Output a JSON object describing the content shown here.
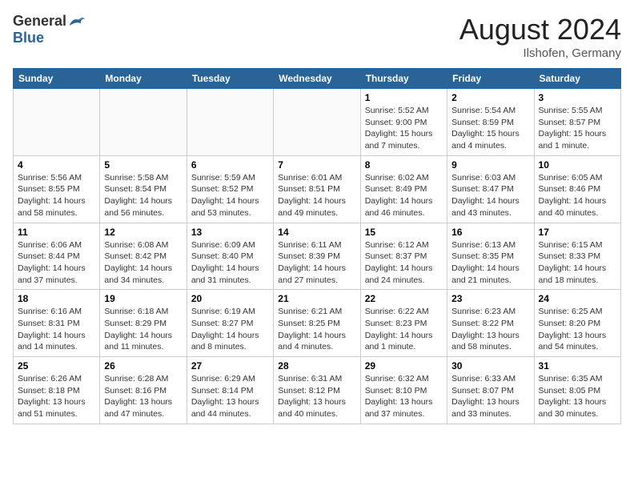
{
  "header": {
    "logo_general": "General",
    "logo_blue": "Blue",
    "month_year": "August 2024",
    "location": "Ilshofen, Germany"
  },
  "days_of_week": [
    "Sunday",
    "Monday",
    "Tuesday",
    "Wednesday",
    "Thursday",
    "Friday",
    "Saturday"
  ],
  "weeks": [
    [
      {
        "day": "",
        "empty": true
      },
      {
        "day": "",
        "empty": true
      },
      {
        "day": "",
        "empty": true
      },
      {
        "day": "",
        "empty": true
      },
      {
        "day": "1",
        "sunrise": "Sunrise: 5:52 AM",
        "sunset": "Sunset: 9:00 PM",
        "daylight": "Daylight: 15 hours and 7 minutes."
      },
      {
        "day": "2",
        "sunrise": "Sunrise: 5:54 AM",
        "sunset": "Sunset: 8:59 PM",
        "daylight": "Daylight: 15 hours and 4 minutes."
      },
      {
        "day": "3",
        "sunrise": "Sunrise: 5:55 AM",
        "sunset": "Sunset: 8:57 PM",
        "daylight": "Daylight: 15 hours and 1 minute."
      }
    ],
    [
      {
        "day": "4",
        "sunrise": "Sunrise: 5:56 AM",
        "sunset": "Sunset: 8:55 PM",
        "daylight": "Daylight: 14 hours and 58 minutes."
      },
      {
        "day": "5",
        "sunrise": "Sunrise: 5:58 AM",
        "sunset": "Sunset: 8:54 PM",
        "daylight": "Daylight: 14 hours and 56 minutes."
      },
      {
        "day": "6",
        "sunrise": "Sunrise: 5:59 AM",
        "sunset": "Sunset: 8:52 PM",
        "daylight": "Daylight: 14 hours and 53 minutes."
      },
      {
        "day": "7",
        "sunrise": "Sunrise: 6:01 AM",
        "sunset": "Sunset: 8:51 PM",
        "daylight": "Daylight: 14 hours and 49 minutes."
      },
      {
        "day": "8",
        "sunrise": "Sunrise: 6:02 AM",
        "sunset": "Sunset: 8:49 PM",
        "daylight": "Daylight: 14 hours and 46 minutes."
      },
      {
        "day": "9",
        "sunrise": "Sunrise: 6:03 AM",
        "sunset": "Sunset: 8:47 PM",
        "daylight": "Daylight: 14 hours and 43 minutes."
      },
      {
        "day": "10",
        "sunrise": "Sunrise: 6:05 AM",
        "sunset": "Sunset: 8:46 PM",
        "daylight": "Daylight: 14 hours and 40 minutes."
      }
    ],
    [
      {
        "day": "11",
        "sunrise": "Sunrise: 6:06 AM",
        "sunset": "Sunset: 8:44 PM",
        "daylight": "Daylight: 14 hours and 37 minutes."
      },
      {
        "day": "12",
        "sunrise": "Sunrise: 6:08 AM",
        "sunset": "Sunset: 8:42 PM",
        "daylight": "Daylight: 14 hours and 34 minutes."
      },
      {
        "day": "13",
        "sunrise": "Sunrise: 6:09 AM",
        "sunset": "Sunset: 8:40 PM",
        "daylight": "Daylight: 14 hours and 31 minutes."
      },
      {
        "day": "14",
        "sunrise": "Sunrise: 6:11 AM",
        "sunset": "Sunset: 8:39 PM",
        "daylight": "Daylight: 14 hours and 27 minutes."
      },
      {
        "day": "15",
        "sunrise": "Sunrise: 6:12 AM",
        "sunset": "Sunset: 8:37 PM",
        "daylight": "Daylight: 14 hours and 24 minutes."
      },
      {
        "day": "16",
        "sunrise": "Sunrise: 6:13 AM",
        "sunset": "Sunset: 8:35 PM",
        "daylight": "Daylight: 14 hours and 21 minutes."
      },
      {
        "day": "17",
        "sunrise": "Sunrise: 6:15 AM",
        "sunset": "Sunset: 8:33 PM",
        "daylight": "Daylight: 14 hours and 18 minutes."
      }
    ],
    [
      {
        "day": "18",
        "sunrise": "Sunrise: 6:16 AM",
        "sunset": "Sunset: 8:31 PM",
        "daylight": "Daylight: 14 hours and 14 minutes."
      },
      {
        "day": "19",
        "sunrise": "Sunrise: 6:18 AM",
        "sunset": "Sunset: 8:29 PM",
        "daylight": "Daylight: 14 hours and 11 minutes."
      },
      {
        "day": "20",
        "sunrise": "Sunrise: 6:19 AM",
        "sunset": "Sunset: 8:27 PM",
        "daylight": "Daylight: 14 hours and 8 minutes."
      },
      {
        "day": "21",
        "sunrise": "Sunrise: 6:21 AM",
        "sunset": "Sunset: 8:25 PM",
        "daylight": "Daylight: 14 hours and 4 minutes."
      },
      {
        "day": "22",
        "sunrise": "Sunrise: 6:22 AM",
        "sunset": "Sunset: 8:23 PM",
        "daylight": "Daylight: 14 hours and 1 minute."
      },
      {
        "day": "23",
        "sunrise": "Sunrise: 6:23 AM",
        "sunset": "Sunset: 8:22 PM",
        "daylight": "Daylight: 13 hours and 58 minutes."
      },
      {
        "day": "24",
        "sunrise": "Sunrise: 6:25 AM",
        "sunset": "Sunset: 8:20 PM",
        "daylight": "Daylight: 13 hours and 54 minutes."
      }
    ],
    [
      {
        "day": "25",
        "sunrise": "Sunrise: 6:26 AM",
        "sunset": "Sunset: 8:18 PM",
        "daylight": "Daylight: 13 hours and 51 minutes."
      },
      {
        "day": "26",
        "sunrise": "Sunrise: 6:28 AM",
        "sunset": "Sunset: 8:16 PM",
        "daylight": "Daylight: 13 hours and 47 minutes."
      },
      {
        "day": "27",
        "sunrise": "Sunrise: 6:29 AM",
        "sunset": "Sunset: 8:14 PM",
        "daylight": "Daylight: 13 hours and 44 minutes."
      },
      {
        "day": "28",
        "sunrise": "Sunrise: 6:31 AM",
        "sunset": "Sunset: 8:12 PM",
        "daylight": "Daylight: 13 hours and 40 minutes."
      },
      {
        "day": "29",
        "sunrise": "Sunrise: 6:32 AM",
        "sunset": "Sunset: 8:10 PM",
        "daylight": "Daylight: 13 hours and 37 minutes."
      },
      {
        "day": "30",
        "sunrise": "Sunrise: 6:33 AM",
        "sunset": "Sunset: 8:07 PM",
        "daylight": "Daylight: 13 hours and 33 minutes."
      },
      {
        "day": "31",
        "sunrise": "Sunrise: 6:35 AM",
        "sunset": "Sunset: 8:05 PM",
        "daylight": "Daylight: 13 hours and 30 minutes."
      }
    ]
  ]
}
